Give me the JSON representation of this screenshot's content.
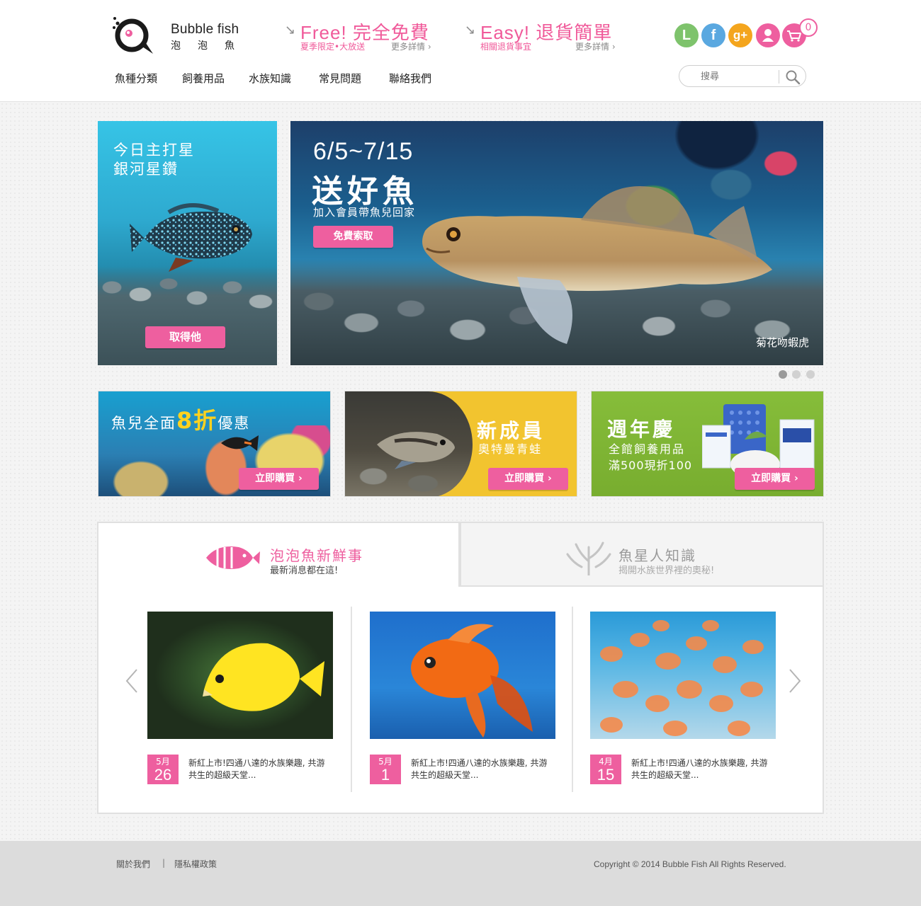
{
  "brand": {
    "name": "Bubble fish",
    "sub": "泡泡魚",
    "accent_color": "#ee5f9f"
  },
  "promos": [
    {
      "arrow": "↘",
      "title": "Free! 完全免費",
      "subtitle": "夏季限定•大放送",
      "more": "更多詳情 ›"
    },
    {
      "arrow": "↘",
      "title": "Easy! 退貨簡單",
      "subtitle": "相關退貨事宜",
      "more": "更多詳情 ›"
    }
  ],
  "social_icons": [
    {
      "name": "line-icon",
      "glyph": "L"
    },
    {
      "name": "facebook-icon",
      "glyph": "f"
    },
    {
      "name": "google-plus-icon",
      "glyph": "g+"
    },
    {
      "name": "user-icon",
      "glyph": ""
    },
    {
      "name": "cart-icon",
      "glyph": ""
    }
  ],
  "cart_count": "0",
  "nav": [
    "魚種分類",
    "飼養用品",
    "水族知識",
    "常見問題",
    "聯絡我們"
  ],
  "search": {
    "placeholder": "搜尋"
  },
  "hero_left": {
    "line1": "今日主打星",
    "line2": "銀河星鑽",
    "button": "取得他"
  },
  "hero_main": {
    "date": "6/5~7/15",
    "headline": "送好魚",
    "sub": "加入會員帶魚兒回家",
    "button": "免費索取",
    "caption": "菊花吻蝦虎"
  },
  "slider": {
    "count": 3,
    "active": 0
  },
  "banners": [
    {
      "pre": "魚兒全面",
      "highlight": "8折",
      "post": "優惠",
      "button": "立即購買"
    },
    {
      "title": "新成員",
      "subtitle": "奧特曼青蛙",
      "button": "立即購買"
    },
    {
      "title": "週年慶",
      "subtitle": "全館飼養用品",
      "detail": "滿500現折100",
      "button": "立即購買"
    }
  ],
  "tabs": [
    {
      "title": "泡泡魚新鮮事",
      "desc": "最新消息都在這!"
    },
    {
      "title": "魚星人知識",
      "desc": "揭開水族世界裡的奧秘!"
    }
  ],
  "news": [
    {
      "month": "5月",
      "day": "26",
      "text": "新紅上市!四通八達的水族樂趣, 共游共生的超級天堂..."
    },
    {
      "month": "5月",
      "day": "1",
      "text": "新紅上市!四通八達的水族樂趣, 共游共生的超級天堂..."
    },
    {
      "month": "4月",
      "day": "15",
      "text": "新紅上市!四通八達的水族樂趣, 共游共生的超級天堂..."
    }
  ],
  "footer": {
    "about": "關於我們",
    "separator": "|",
    "privacy": "隱私權政策",
    "copyright": "Copyright © 2014 Bubble Fish All Rights Reserved."
  }
}
